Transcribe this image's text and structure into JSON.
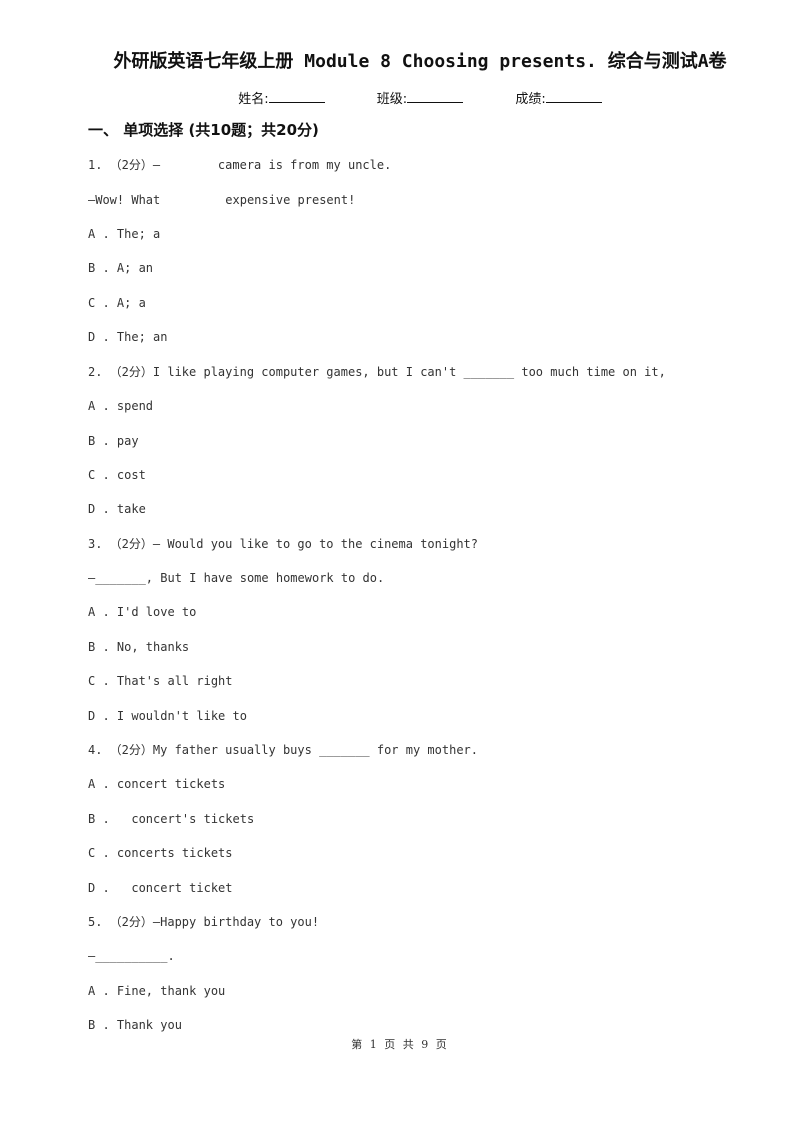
{
  "title": "外研版英语七年级上册 Module 8 Choosing presents. 综合与测试A卷",
  "info": {
    "name_label": "姓名:",
    "class_label": "班级:",
    "score_label": "成绩:"
  },
  "section": {
    "heading": "一、 单项选择 (共10题；共20分)"
  },
  "questions": [
    {
      "lines": [
        "1. （2分）—        camera is from my uncle.",
        "—Wow! What         expensive present!"
      ],
      "options": [
        "A . The; a",
        "B . A; an",
        "C . A; a",
        "D . The; an"
      ]
    },
    {
      "lines": [
        "2. （2分）I like playing computer games, but I can't _______ too much time on it,"
      ],
      "options": [
        "A . spend",
        "B . pay",
        "C . cost",
        "D . take"
      ]
    },
    {
      "lines": [
        "3. （2分）— Would you like to go to the cinema tonight?",
        "—_______, But I have some homework to do."
      ],
      "options": [
        "A . I'd love to",
        "B . No, thanks",
        "C . That's all right",
        "D . I wouldn't like to"
      ]
    },
    {
      "lines": [
        "4. （2分）My father usually buys _______ for my mother."
      ],
      "options": [
        "A . concert tickets",
        "B .   concert's tickets",
        "C . concerts tickets",
        "D .   concert ticket"
      ]
    },
    {
      "lines": [
        "5. （2分）—Happy birthday to you!",
        "—__________."
      ],
      "options": [
        "A . Fine, thank you",
        "B . Thank you"
      ]
    }
  ],
  "footer": "第 1 页 共 9 页"
}
